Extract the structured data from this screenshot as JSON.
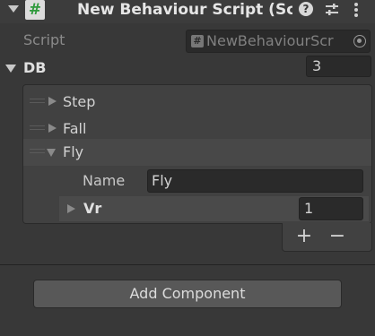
{
  "header": {
    "title": "New Behaviour Script (Sc",
    "script_icon": "#",
    "help_icon": "?",
    "settings_icon": "sliders-icon",
    "more_icon": "vertical-ellipsis-icon"
  },
  "script": {
    "label": "Script",
    "value": "NewBehaviourScr",
    "icon": "#"
  },
  "db": {
    "label": "DB",
    "size": "3",
    "items": [
      {
        "label": "Step",
        "expanded": false
      },
      {
        "label": "Fall",
        "expanded": false
      },
      {
        "label": "Fly",
        "expanded": true
      }
    ],
    "fly": {
      "name_label": "Name",
      "name_value": "Fly",
      "vr_label": "Vr",
      "vr_value": "1"
    },
    "add_label": "+",
    "remove_label": "−"
  },
  "add_component_label": "Add Component",
  "colors": {
    "background": "#383838",
    "script_icon_green": "#2e9a3c"
  }
}
